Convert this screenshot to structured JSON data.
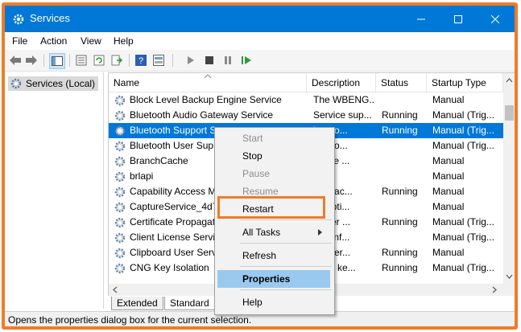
{
  "window": {
    "title": "Services"
  },
  "menu": [
    "File",
    "Action",
    "View",
    "Help"
  ],
  "tree": {
    "root_label": "Services (Local)"
  },
  "columns": {
    "name": "Name",
    "description": "Description",
    "status": "Status",
    "startup": "Startup Type"
  },
  "services": [
    {
      "name": "Block Level Backup Engine Service",
      "description": "The WBENG...",
      "status": "",
      "startup": "Manual"
    },
    {
      "name": "Bluetooth Audio Gateway Service",
      "description": "Service sup...",
      "status": "Running",
      "startup": "Manual (Trig..."
    },
    {
      "name": "Bluetooth Support Se",
      "description": "luetoo...",
      "status": "Running",
      "startup": "Manual (Trig...",
      "selected": true
    },
    {
      "name": "Bluetooth User Suppo",
      "description": "luetoo...",
      "status": "",
      "startup": "Manual (Trig..."
    },
    {
      "name": "BranchCache",
      "description": "ervice ...",
      "status": "",
      "startup": "Manual"
    },
    {
      "name": "brlapi",
      "description": "",
      "status": "",
      "startup": "Manual"
    },
    {
      "name": "Capability Access Ma",
      "description": "des fac...",
      "status": "Running",
      "startup": "Manual"
    },
    {
      "name": "CaptureService_4d76",
      "description": "es opti...",
      "status": "",
      "startup": "Manual"
    },
    {
      "name": "Certificate Propagatic",
      "description": "s user ...",
      "status": "Running",
      "startup": "Manual (Trig..."
    },
    {
      "name": "Client License Service",
      "description": "des inf...",
      "status": "",
      "startup": "Manual (Trig..."
    },
    {
      "name": "Clipboard User Servic",
      "description": "ser ser...",
      "status": "Running",
      "startup": "Manual"
    },
    {
      "name": "CNG Key Isolation",
      "description": "CNG ke...",
      "status": "Running",
      "startup": "Manual (Trig..."
    }
  ],
  "tabs": {
    "extended": "Extended",
    "standard": "Standard"
  },
  "status_text": "Opens the properties dialog box for the current selection.",
  "context_menu": {
    "start": "Start",
    "stop": "Stop",
    "pause": "Pause",
    "resume": "Resume",
    "restart": "Restart",
    "all_tasks": "All Tasks",
    "refresh": "Refresh",
    "properties": "Properties",
    "help": "Help"
  },
  "colors": {
    "accent": "#0078d7",
    "highlight_box": "#f07b27",
    "menu_hover": "#99c9ef"
  },
  "icons": [
    "gear-icon",
    "back-arrow-icon",
    "forward-arrow-icon",
    "play-icon",
    "stop-icon",
    "pause-icon",
    "restart-icon"
  ]
}
